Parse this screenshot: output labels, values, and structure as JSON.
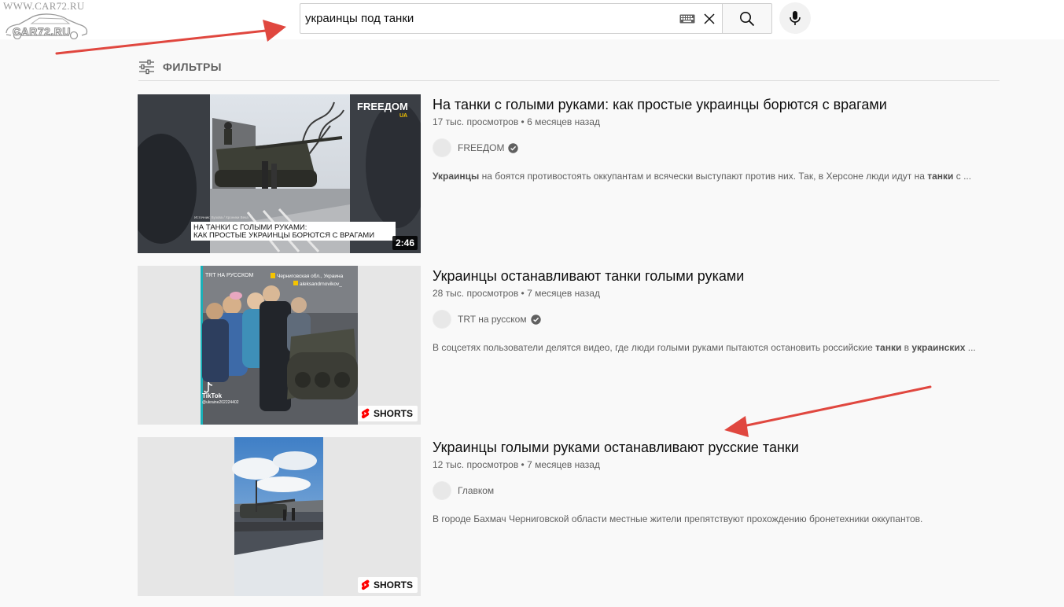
{
  "watermark": {
    "url": "WWW.CAR72.RU",
    "name": "CAR72.RU"
  },
  "search": {
    "query": "украинцы под танки"
  },
  "filters": {
    "label": "ФИЛЬТРЫ"
  },
  "colors": {
    "accent": "#ff0000",
    "annotation_arrow": "#e0473f",
    "verified": "#606060"
  },
  "results": [
    {
      "title": "На танки с голыми руками: как простые украинцы борются с врагами",
      "views": "17 тыс. просмотров",
      "age": "6 месяцев назад",
      "channel": "FREEДОМ",
      "verified": true,
      "desc_parts": [
        {
          "b": "Украинцы"
        },
        {
          "t": " на боятся противостоять оккупантам и всячески выступают против них. Так, в Херсоне люди идут на "
        },
        {
          "b": "танки"
        },
        {
          "t": " с ..."
        }
      ],
      "badge": "duration",
      "duration": "2:46",
      "thumb_caption_small": "Источник: Бузова / Хроники Века",
      "thumb_caption_line1": "НА ТАНКИ С ГОЛЫМИ РУКАМИ:",
      "thumb_caption_line2": "КАК ПРОСТЫЕ УКРАИНЦЫ БОРЮТСЯ С ВРАГАМИ",
      "thumb_logo": "FREEДОМ",
      "thumb_logo_sub": "UA"
    },
    {
      "title": "Украинцы останавливают танки голыми руками",
      "views": "28 тыс. просмотров",
      "age": "7 месяцев назад",
      "channel": "TRT на русском",
      "verified": true,
      "desc_parts": [
        {
          "t": "В соцсетях пользователи делятся видео, где люди голыми руками пытаются остановить российские "
        },
        {
          "b": "танки"
        },
        {
          "t": " в "
        },
        {
          "b": "украинских"
        },
        {
          "t": " ..."
        }
      ],
      "badge": "shorts",
      "shorts_label": "SHORTS",
      "thumb_tag": "TRT НА РУССКОМ",
      "thumb_loc": "Черниговская обл., Украина",
      "thumb_user": "aleksandrnovikov_",
      "thumb_tiktok": "TikTok",
      "thumb_tiktok_user": "@ukraine202224402"
    },
    {
      "title": "Украинцы голыми руками останавливают русские танки",
      "views": "12 тыс. просмотров",
      "age": "7 месяцев назад",
      "channel": "Главком",
      "verified": false,
      "desc_parts": [
        {
          "t": "В городе Бахмач Черниговской области местные жители препятствуют прохождению бронетехники оккупантов."
        }
      ],
      "badge": "shorts",
      "shorts_label": "SHORTS"
    }
  ]
}
